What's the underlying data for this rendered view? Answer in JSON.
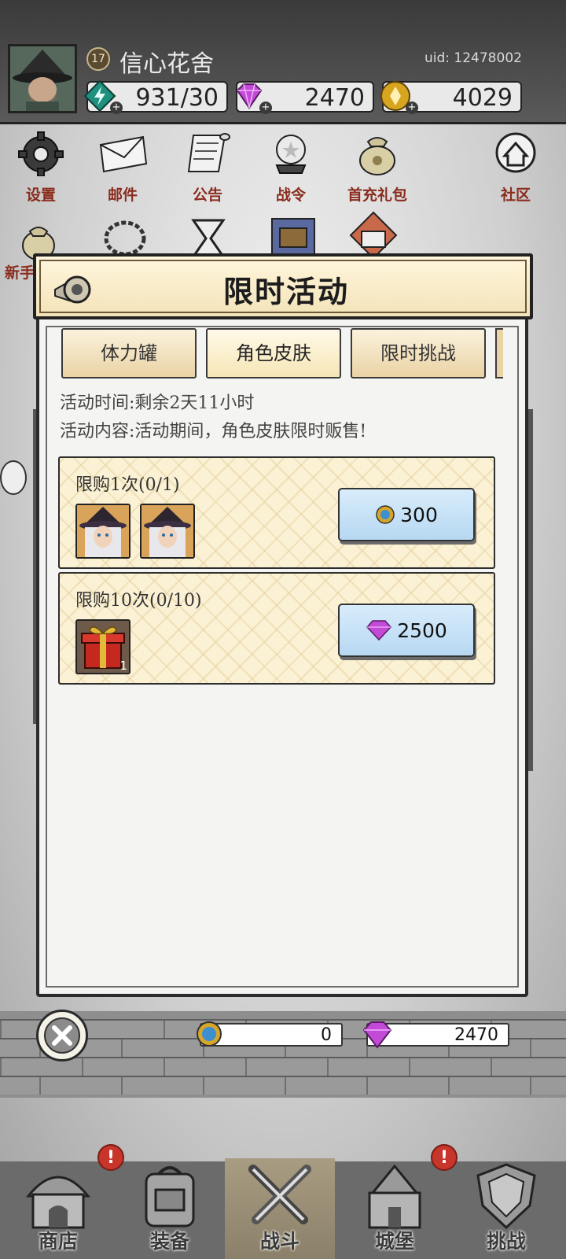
{
  "player": {
    "level": "17",
    "name": "信心花舍",
    "uid": "uid: 12478002"
  },
  "resources": {
    "stamina": "931/30",
    "gems": "2470",
    "coins": "4029"
  },
  "menu": {
    "settings": "设置",
    "mail": "邮件",
    "notice": "公告",
    "battle_pass": "战令",
    "first_recharge": "首充礼包",
    "community": "社区",
    "newbie_partial": "新手"
  },
  "modal": {
    "title": "限时活动",
    "tabs": [
      "体力罐",
      "角色皮肤",
      "限时挑战"
    ],
    "active_tab": 1,
    "time_line": "活动时间:剩余2天11小时",
    "content_line": "活动内容:活动期间，角色皮肤限时贩售!",
    "offers": [
      {
        "limit": "限购1次(0/1)",
        "price": "300",
        "currency": "blue-coin-icon",
        "items": [
          "witch-skin-portrait",
          "witch-skin-portrait"
        ]
      },
      {
        "limit": "限购10次(0/10)",
        "price": "2500",
        "currency": "gem-icon",
        "items": [
          "gift-box"
        ],
        "item_count": "1"
      }
    ]
  },
  "currency_bar": {
    "blue_coins": "0",
    "gems": "2470"
  },
  "nav": {
    "shop": "商店",
    "equipment": "装备",
    "battle": "战斗",
    "castle": "城堡",
    "challenge": "挑战",
    "active": "battle",
    "badge": "!"
  },
  "colors": {
    "menu_label": "#8a2c1e",
    "buy_button": "#b7d8f2",
    "offer_bg": "#fbf1d4",
    "badge": "#c8352a"
  }
}
